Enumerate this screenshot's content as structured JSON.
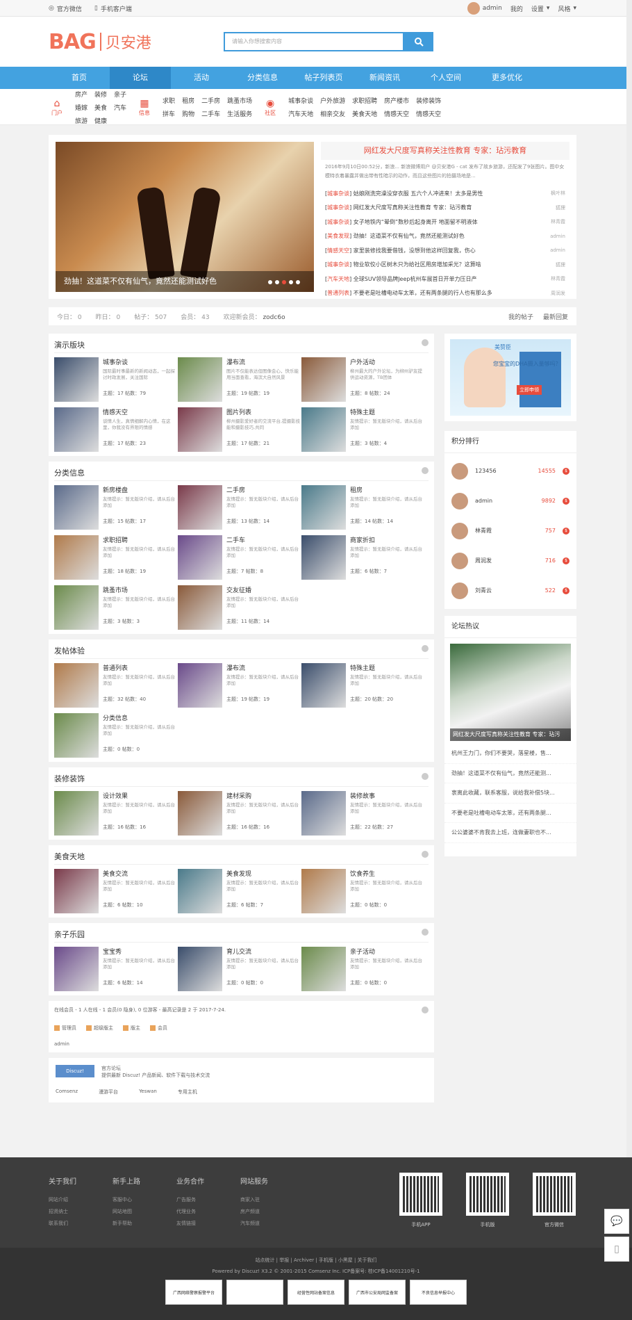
{
  "topbar": {
    "wechat": "官方微信",
    "mobile": "手机客户端",
    "user": "admin",
    "mine": "我的",
    "settings": "设置",
    "style": "风格"
  },
  "header": {
    "logo_en": "BAG",
    "logo_cn": "贝安港",
    "search_placeholder": "请输入你想搜索内容"
  },
  "nav": [
    "首页",
    "论坛",
    "活动",
    "分类信息",
    "帖子列表页",
    "新闻资讯",
    "个人空间",
    "更多优化"
  ],
  "subnav": [
    {
      "icon": "门户",
      "links": [
        "房产",
        "装修",
        "亲子",
        "婚嫁",
        "美食",
        "汽车",
        "旅游",
        "健康"
      ]
    },
    {
      "icon": "信息",
      "links": [
        "求职",
        "租房",
        "二手房",
        "跳蚤市场",
        "拼车",
        "购物",
        "二手车",
        "生活服务"
      ]
    },
    {
      "icon": "社区",
      "links": [
        "城事杂谈",
        "户外旅游",
        "求职招聘",
        "房产楼市",
        "装修装饰",
        "汽车天地",
        "相亲交友",
        "美食天地",
        "情感天空",
        "情感天空"
      ]
    }
  ],
  "banner": {
    "caption": "劲抽！这道菜不仅有仙气，竟然还能测试好色",
    "headline": "网红发大尺度写真称关注性教育 专家：玷污教育",
    "summary": "2016年9月10日00:52分，新浪... 新浪微博用户 @贝安港G - cat 发布了故乡旅游，还配发了9张图片。图中女模特衣着暴露并做出带有性暗示的动作，而且这些图片的拍摄场地是..."
  },
  "hot_list": [
    {
      "tag": "城事杂谈",
      "title": "姑娘刚洗完澡没穿衣服 五六个人冲进来！太多是男性",
      "author": "枫叶林"
    },
    {
      "tag": "城事杂谈",
      "title": "网红发大尺度写真称关注性教育 专家：玷污教育",
      "author": "狐狸"
    },
    {
      "tag": "城事杂谈",
      "title": "女子地铁内“晕倒”数秒后起身离开 地面留不明液体",
      "author": "林青霞"
    },
    {
      "tag": "美食发现",
      "title": "劲抽！这道菜不仅有仙气，竟然还能测试好色",
      "author": "admin"
    },
    {
      "tag": "情感天空",
      "title": "家里装修找我要借钱，没想到他这样回复我，伤心",
      "author": "admin"
    },
    {
      "tag": "城事杂谈",
      "title": "物业软佼小区树木只为给社区用房增加采光？这算啥",
      "author": "狐狸"
    },
    {
      "tag": "汽车天地",
      "title": "全球SUV领导品牌Jeep杭州车展首日开单力压日产",
      "author": "林青霞"
    },
    {
      "tag": "普通列表",
      "title": "不要老是吐槽电动车太笨，还有两条腿的行人也有那么多",
      "author": "周润发"
    }
  ],
  "stats": {
    "today": "今日： 0",
    "yesterday": "昨日： 0",
    "posts": "帖子： 507",
    "members": "会员： 43",
    "welcome": "欢迎新会员：",
    "new_member": "zodc6o",
    "my_posts": "我的帖子",
    "latest": "最新回复"
  },
  "sections": [
    {
      "title": "演示版块",
      "items": [
        {
          "name": "城事杂谈",
          "desc": "国际最时事最新的新闻动态，一起探讨时政发展，关注国际",
          "count": "主题：17  帖数：79"
        },
        {
          "name": "瀑布流",
          "desc": "图片不仅能表达但图像会心，快乐能用当面查看，海滨大自然风景",
          "count": "主题：19  帖数：19"
        },
        {
          "name": "户外活动",
          "desc": "柳州最大的户外论坛，为柳州驴友提供运动资源，TB团体",
          "count": "主题：8  帖数：24"
        },
        {
          "name": "情感天空",
          "desc": "谈情人生，真情细解内心情，在这里，你我没有界限的情感",
          "count": "主题：17  帖数：23"
        },
        {
          "name": "图片列表",
          "desc": "柳州摄影爱好者的交流平台,提摄影技能和摄影技巧,共同",
          "count": "主题：17  帖数：21"
        },
        {
          "name": "特殊主题",
          "desc": "友情提示：暂无版块介绍，请从后台添加",
          "count": "主题：3  帖数：4"
        }
      ]
    },
    {
      "title": "分类信息",
      "items": [
        {
          "name": "新房楼盘",
          "desc": "友情提示：暂无版块介绍，请从后台添加",
          "count": "主题：15  帖数：17"
        },
        {
          "name": "二手房",
          "desc": "友情提示：暂无版块介绍，请从后台添加",
          "count": "主题：13  帖数：14"
        },
        {
          "name": "租房",
          "desc": "友情提示：暂无版块介绍，请从后台添加",
          "count": "主题：14  帖数：14"
        },
        {
          "name": "求职招聘",
          "desc": "友情提示：暂无版块介绍，请从后台添加",
          "count": "主题：18  帖数：19"
        },
        {
          "name": "二手车",
          "desc": "友情提示：暂无版块介绍，请从后台添加",
          "count": "主题：7  帖数：8"
        },
        {
          "name": "商家折扣",
          "desc": "友情提示：暂无版块介绍，请从后台添加",
          "count": "主题：6  帖数：7"
        },
        {
          "name": "跳蚤市场",
          "desc": "友情提示：暂无版块介绍，请从后台添加",
          "count": "主题：3  帖数：3"
        },
        {
          "name": "交友征婚",
          "desc": "友情提示：暂无版块介绍，请从后台添加",
          "count": "主题：11  帖数：14"
        }
      ]
    },
    {
      "title": "发帖体验",
      "items": [
        {
          "name": "普通列表",
          "desc": "友情提示：暂无版块介绍，请从后台添加",
          "count": "主题：32  帖数：40"
        },
        {
          "name": "瀑布流",
          "desc": "友情提示：暂无版块介绍，请从后台添加",
          "count": "主题：19  帖数：19"
        },
        {
          "name": "特殊主题",
          "desc": "友情提示：暂无版块介绍，请从后台添加",
          "count": "主题：20  帖数：20"
        },
        {
          "name": "分类信息",
          "desc": "友情提示：暂无版块介绍，请从后台添加",
          "count": "主题：0  帖数：0"
        }
      ]
    },
    {
      "title": "装修装饰",
      "items": [
        {
          "name": "设计效果",
          "desc": "友情提示：暂无版块介绍，请从后台添加",
          "count": "主题：16  帖数：16"
        },
        {
          "name": "建材采购",
          "desc": "友情提示：暂无版块介绍，请从后台添加",
          "count": "主题：16  帖数：16"
        },
        {
          "name": "装修故事",
          "desc": "友情提示：暂无版块介绍，请从后台添加",
          "count": "主题：22  帖数：27"
        }
      ]
    },
    {
      "title": "美食天地",
      "items": [
        {
          "name": "美食交流",
          "desc": "友情提示：暂无版块介绍，请从后台添加",
          "count": "主题：6  帖数：10"
        },
        {
          "name": "美食发现",
          "desc": "友情提示：暂无版块介绍，请从后台添加",
          "count": "主题：6  帖数：7"
        },
        {
          "name": "饮食养生",
          "desc": "友情提示：暂无版块介绍，请从后台添加",
          "count": "主题：0  帖数：0"
        }
      ]
    },
    {
      "title": "亲子乐园",
      "items": [
        {
          "name": "宝宝秀",
          "desc": "友情提示：暂无版块介绍，请从后台添加",
          "count": "主题：6  帖数：14"
        },
        {
          "name": "育儿交流",
          "desc": "友情提示：暂无版块介绍，请从后台添加",
          "count": "主题：0  帖数：0"
        },
        {
          "name": "亲子活动",
          "desc": "友情提示：暂无版块介绍，请从后台添加",
          "count": "主题：0  帖数：0"
        }
      ]
    }
  ],
  "online": {
    "line": "在线会员 - 1 人在线 - 1 会员(0 隐身), 0 位游客 - 最高记录是 2 于 2017-7-24.",
    "roles": [
      "管理员",
      "超级版主",
      "版主",
      "会员"
    ],
    "member": "admin"
  },
  "links": {
    "logo": "Discuz!",
    "name": "官方论坛",
    "desc": "提供最新 Discuz! 产品新闻、软件下载与技术交流",
    "list": [
      "Comsenz",
      "漫游平台",
      "Yeswan",
      "专用主机"
    ]
  },
  "ad": {
    "brand": "美赞臣",
    "text": "您宝宝的DHA摄入量够吗？",
    "tag": "立即申领"
  },
  "rank": {
    "title": "积分排行",
    "items": [
      {
        "name": "123456",
        "score": "14555"
      },
      {
        "name": "admin",
        "score": "9892"
      },
      {
        "name": "林青霞",
        "score": "757"
      },
      {
        "name": "周润发",
        "score": "716"
      },
      {
        "name": "刘青云",
        "score": "522"
      }
    ]
  },
  "forum": {
    "title": "论坛热议",
    "caption": "网红发大尺度写真称关注性教育 专家：玷污",
    "items": [
      "杭州王力门，你们不要哭，落星楼，售...",
      "劲抽！这道菜不仅有仙气，竟然还能测...",
      "衷离此收藏，联系客服，说给我补偿5块...",
      "不要老是吐槽电动车太笨，还有两条腿...",
      "公公婆婆不肯我去上班，连做妻职也不..."
    ]
  },
  "footer": {
    "cols": [
      {
        "title": "关于我们",
        "items": [
          "网站介绍",
          "招贤纳士",
          "联系我们"
        ]
      },
      {
        "title": "新手上路",
        "items": [
          "客服中心",
          "网站地图",
          "新手帮助"
        ]
      },
      {
        "title": "业务合作",
        "items": [
          "广告服务",
          "代理业务",
          "友情链接"
        ]
      },
      {
        "title": "网站服务",
        "items": [
          "商家入驻",
          "房产频道",
          "汽车频道"
        ]
      }
    ],
    "qrs": [
      "手机APP",
      "手机版",
      "官方微信"
    ],
    "bottom_links": "站点统计 | 举报 | Archiver | 手机版 | 小黑屋 | 关于我们",
    "powered": "Powered by Discuz! X3.2  © 2001-2015 Comsenz Inc.  ICP备案号: 桂ICP备14001210号-1",
    "badges": [
      "广西网络警察报警平台",
      "",
      "经营性网站备案信息",
      "广西市公安局网监备案",
      "不良信息举报中心"
    ]
  }
}
